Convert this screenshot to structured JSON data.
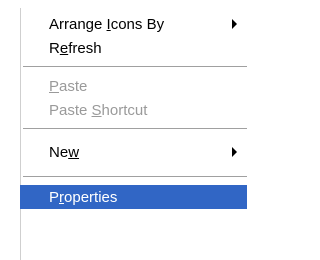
{
  "menu": {
    "arrange": {
      "pre": "Arrange ",
      "key": "I",
      "post": "cons By"
    },
    "refresh": {
      "pre": "R",
      "key": "e",
      "post": "fresh"
    },
    "paste": {
      "pre": "",
      "key": "P",
      "post": "aste"
    },
    "paste_shortcut": {
      "pre": "Paste ",
      "key": "S",
      "post": "hortcut"
    },
    "new": {
      "pre": "Ne",
      "key": "w",
      "post": ""
    },
    "properties": {
      "pre": "P",
      "key": "r",
      "post": "operties"
    }
  },
  "colors": {
    "selection": "#3166c5",
    "disabled_text": "#9a9a9a",
    "separator": "#a0a0a0"
  },
  "icons": {
    "submenu": "submenu-arrow-icon"
  }
}
